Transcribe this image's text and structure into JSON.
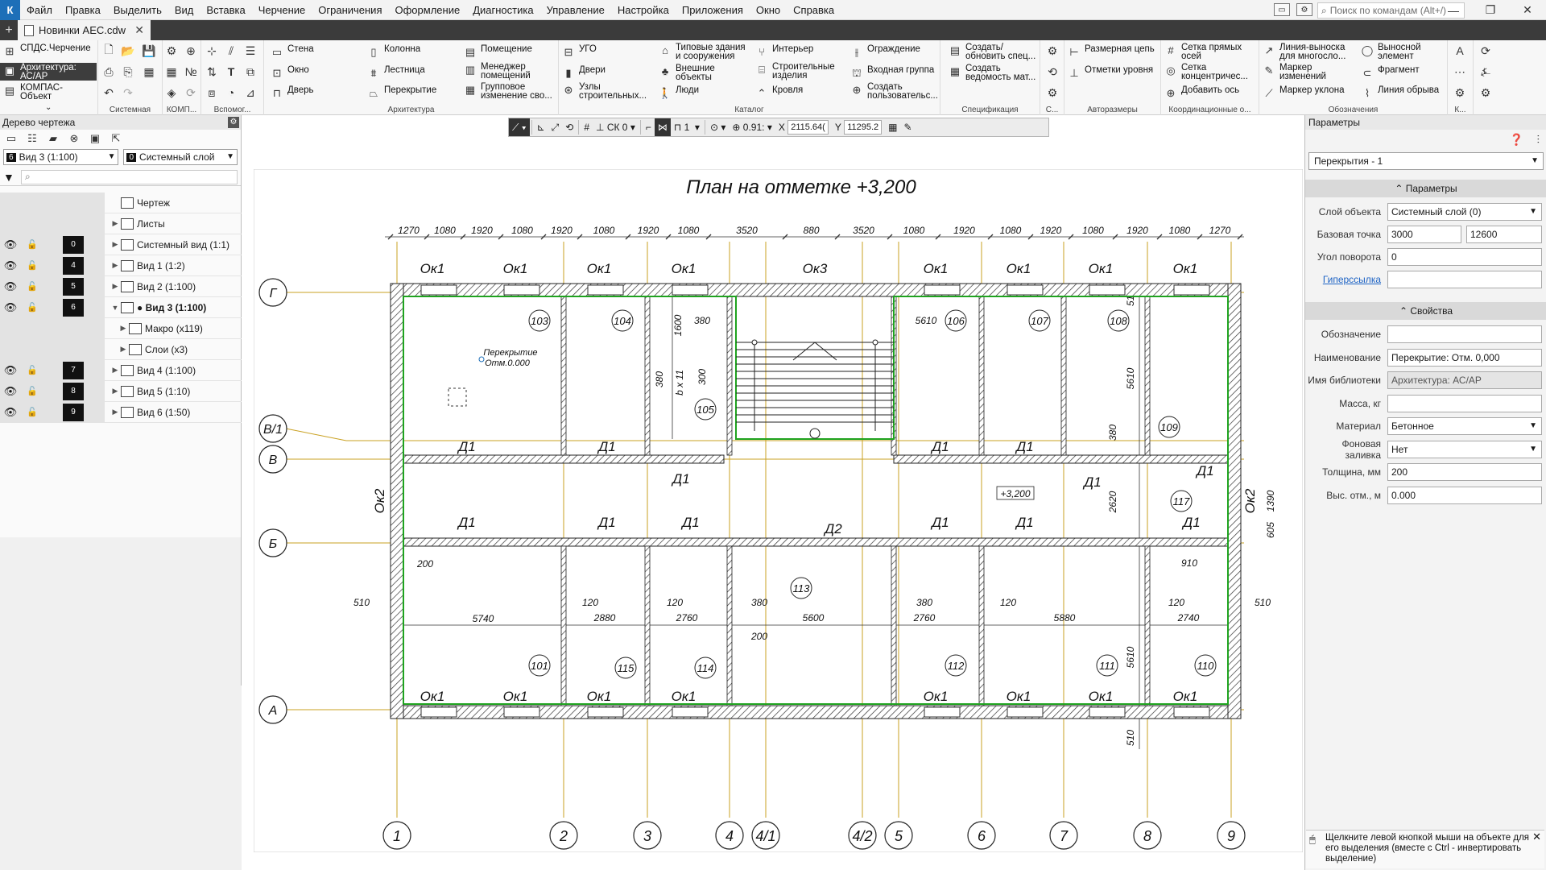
{
  "menubar": {
    "items": [
      "Файл",
      "Правка",
      "Выделить",
      "Вид",
      "Вставка",
      "Черчение",
      "Ограничения",
      "Оформление",
      "Диагностика",
      "Управление",
      "Настройка",
      "Приложения",
      "Окно",
      "Справка"
    ],
    "search_placeholder": "Поиск по командам (Alt+/)"
  },
  "tabs": [
    {
      "label": "Новинки AEC.cdw"
    }
  ],
  "ribbon": {
    "left_items": [
      "СПДС.Черчение",
      "Архитектура: АС/АР",
      "КОМПАС-Объект"
    ],
    "groups": {
      "sistemnaya": "Системная",
      "komp": "КОМП...",
      "vspomog": "Вспомог...",
      "arkhitektura": "Архитектура",
      "katalog": "Каталог",
      "specifikaciya": "Спецификация",
      "s": "С...",
      "avtorazmery": "Авторазмеры",
      "koord": "Координационные о...",
      "oboznacheniya": "Обозначения",
      "k": "К..."
    },
    "buttons": {
      "stena": "Стена",
      "okno": "Окно",
      "dver": "Дверь",
      "kolonna": "Колонна",
      "lestnica": "Лестница",
      "perekrytie": "Перекрытие",
      "pomeshchenie": "Помещение",
      "menedzher": "Менеджер помещений",
      "gruppovoe": "Групповое изменение сво...",
      "ugo": "УГО",
      "dveri": "Двери",
      "uzly": "Узлы строительных...",
      "tipovye": "Типовые здания и сооружения",
      "vneshnie": "Внешние объекты",
      "lyudi": "Люди",
      "interer": "Интерьер",
      "stroitelnye": "Строительные изделия",
      "krovlya": "Кровля",
      "ograzhdenie": "Ограждение",
      "vkhodnaya": "Входная группа",
      "sozdat_polz": "Создать пользовательс...",
      "sozdat_obnovit": "Создать/ обновить спец...",
      "sozdat_vedomost": "Создать ведомость мат...",
      "razmernaya": "Размерная цепь",
      "otmetki": "Отметки уровня",
      "setka_pryamykh": "Сетка прямых осей",
      "setka_konc": "Сетка концентричес...",
      "dobavit_os": "Добавить ось",
      "liniya_vynoska": "Линия-выноска для многосло...",
      "marker_izm": "Маркер изменений",
      "marker_uklona": "Маркер уклона",
      "vynosnoy": "Выносной элемент",
      "fragment": "Фрагмент",
      "liniya_obryva": "Линия обрыва"
    }
  },
  "left_panel": {
    "title": "Дерево чертежа",
    "view_combo": {
      "num": "6",
      "label": "Вид 3 (1:100)"
    },
    "layer_combo": {
      "num": "0",
      "label": "Системный слой"
    },
    "tree": [
      {
        "label": "Чертеж",
        "layer": ""
      },
      {
        "label": "Листы",
        "layer": ""
      },
      {
        "label": "Системный вид (1:1)",
        "layer": "0"
      },
      {
        "label": "Вид 1 (1:2)",
        "layer": "4"
      },
      {
        "label": "Вид 2 (1:100)",
        "layer": "5"
      },
      {
        "label": "● Вид 3 (1:100)",
        "layer": "6"
      },
      {
        "label": "Макро (x119)",
        "layer": ""
      },
      {
        "label": "Слои (x3)",
        "layer": ""
      },
      {
        "label": "Вид 4 (1:100)",
        "layer": "7"
      },
      {
        "label": "Вид 5 (1:10)",
        "layer": "8"
      },
      {
        "label": "Вид 6 (1:50)",
        "layer": "9"
      }
    ]
  },
  "canvas_toolbar": {
    "sk": "СК 0",
    "num": "1",
    "zoom": "0.91:",
    "x_label": "X",
    "x_value": "2115.64(",
    "y_label": "Y",
    "y_value": "11295.2"
  },
  "drawing": {
    "title": "План на отметке +3,200",
    "dims_top": [
      "1270",
      "1080",
      "1920",
      "1080",
      "1920",
      "1080",
      "1920",
      "1080",
      "3520",
      "880",
      "3520",
      "1080",
      "1920",
      "1080",
      "1920",
      "1080",
      "1920",
      "1080",
      "1270"
    ],
    "axes_bottom": [
      "1",
      "2",
      "3",
      "4",
      "4/1",
      "4/2",
      "5",
      "6",
      "7",
      "8",
      "9"
    ],
    "axes_left": [
      "Г",
      "В/1",
      "В",
      "Б",
      "А"
    ],
    "room_numbers": [
      "103",
      "104",
      "105",
      "106",
      "107",
      "108",
      "109",
      "117",
      "113",
      "101",
      "115",
      "114",
      "112",
      "111",
      "110"
    ],
    "labels": {
      "ok1": "Ок1",
      "ok2": "Ок2",
      "ok3": "Ок3",
      "d1": "Д1",
      "d2": "Д2",
      "level": "+3,200",
      "slab_label1": "Перекрытие",
      "slab_label2": "Отм.0.000",
      "b_x_11": "b x 11"
    },
    "dims_inner": [
      "380",
      "1600",
      "300",
      "5610",
      "380",
      "5610",
      "380",
      "2620",
      "1390",
      "605",
      "910",
      "200",
      "510",
      "5740",
      "120",
      "2880",
      "120",
      "2760",
      "380",
      "5600",
      "200",
      "380",
      "2760",
      "120",
      "5880",
      "120",
      "2740",
      "510",
      "5610",
      "510",
      "510"
    ]
  },
  "right_panel": {
    "title": "Параметры",
    "object_combo": "Перекрытия - 1",
    "section_params": "Параметры",
    "section_props": "Свойства",
    "params": [
      {
        "label": "Слой объекта",
        "value": "Системный слой (0)"
      },
      {
        "label": "Базовая точка",
        "value": "3000",
        "value2": "12600"
      },
      {
        "label": "Угол поворота",
        "value": "0"
      },
      {
        "label": "Гиперссылка",
        "value": ""
      }
    ],
    "props": [
      {
        "label": "Обозначение",
        "value": ""
      },
      {
        "label": "Наименование",
        "value": "Перекрытие: Отм. 0,000"
      },
      {
        "label": "Имя библиотеки",
        "value": "Архитектура: АС/АР"
      },
      {
        "label": "Масса, кг",
        "value": ""
      },
      {
        "label": "Материал",
        "value": "Бетонное"
      },
      {
        "label": "Фоновая заливка",
        "value": "Нет"
      },
      {
        "label": "Толщина, мм",
        "value": "200"
      },
      {
        "label": "Выс. отм., м",
        "value": "0.000"
      }
    ]
  },
  "status_hint": "Щелкните левой кнопкой мыши на объекте для его выделения (вместе с Ctrl - инвертировать выделение)",
  "colors": {
    "wall_outline": "#1fa31f",
    "axis_line": "#c9a020",
    "dimension": "#333333",
    "accent": "#1d6fb8"
  }
}
